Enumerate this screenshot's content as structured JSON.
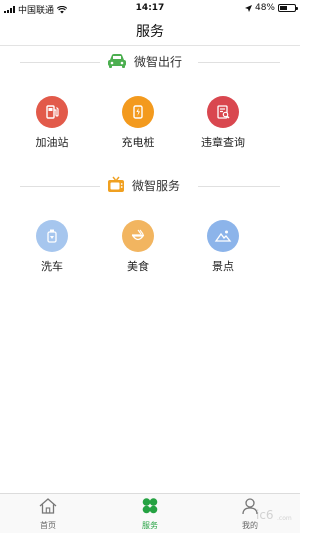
{
  "status_bar": {
    "carrier": "中国联通",
    "time": "14:17",
    "battery": "48%",
    "battery_level": 0.48
  },
  "header": {
    "title": "服务"
  },
  "sections": [
    {
      "title": "微智出行",
      "icon": "car-icon",
      "icon_color": "#4caf50",
      "items": [
        {
          "label": "加油站",
          "icon": "gas-station-icon",
          "color": "#e25a4a"
        },
        {
          "label": "充电桩",
          "icon": "charging-pile-icon",
          "color": "#f39a1e"
        },
        {
          "label": "违章查询",
          "icon": "violation-query-icon",
          "color": "#d9474f"
        }
      ]
    },
    {
      "title": "微智服务",
      "icon": "tv-icon",
      "icon_color": "#f0a020",
      "items": [
        {
          "label": "洗车",
          "icon": "car-wash-icon",
          "color": "#a6c6ee"
        },
        {
          "label": "美食",
          "icon": "food-icon",
          "color": "#f2b560"
        },
        {
          "label": "景点",
          "icon": "scenery-icon",
          "color": "#8cb4ea"
        }
      ]
    }
  ],
  "tab_bar": {
    "active_color": "#25a242",
    "tabs": [
      {
        "label": "首页",
        "icon": "home-icon",
        "active": false
      },
      {
        "label": "服务",
        "icon": "clover-icon",
        "active": true
      },
      {
        "label": "我的",
        "icon": "person-icon",
        "active": false
      }
    ]
  }
}
